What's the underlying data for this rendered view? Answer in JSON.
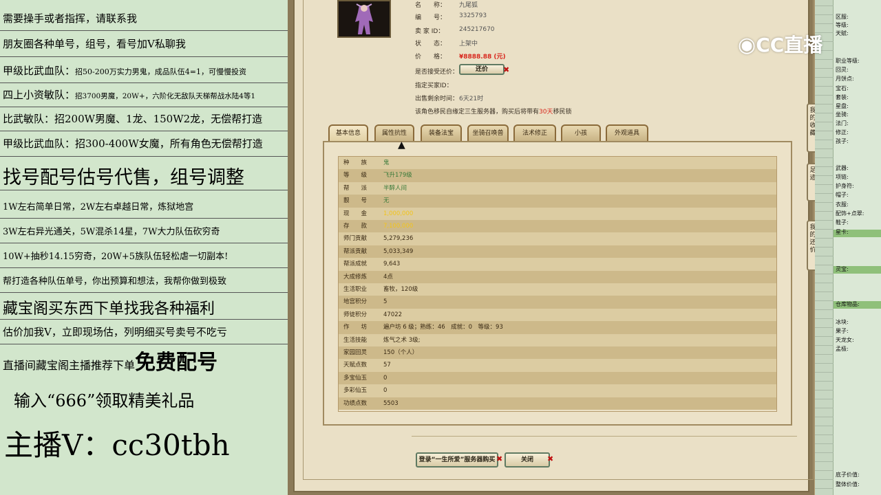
{
  "promo": {
    "l1": "需要操手或者指挥，请联系我",
    "l2": "朋友圈各种单号，组号，看号加Ⅴ私聊我",
    "l3a": "甲级比武血队：",
    "l3b": "招50-200万实力男鬼，成品队伍4=1，可慢慢投资",
    "l4a": "四上小资敏队：",
    "l4b": "招3700男魔，20W+，六阶化无敌队天梯帮战水陆4等1",
    "l5": "比武敏队：招200W男魔、1龙、150W2龙，无偿帮打造",
    "l6": "甲级比武血队：招300-400W女魔，所有角色无偿帮打造",
    "l7": "找号配号估号代售，组号调整",
    "l8": "1W左右简单日常，2W左右卓越日常，炼狱地宫",
    "l9": "3W左右异光通关，5W混杀14星，7W大力队伍砍穷奇",
    "l10": "10W+抽秒14.15穷奇，20W+5族队伍轻松虐一切副本!",
    "l11": "帮打造各种队伍单号，你出预算和想法，我帮你做到极致",
    "l12": "藏宝阁买东西下单找我各种福利",
    "l13": "估价加我Ⅴ，立即现场估，列明细买号卖号不吃亏",
    "l14a": "直播间藏宝阁主播推荐下单",
    "l14b": "免费配号",
    "l15": "输入“666”领取精美礼品",
    "l16": "主播Ⅴ：cc30tbh"
  },
  "listing": {
    "name_label": "名　　称：",
    "name": "九尾狐",
    "id_label": "编　　号：",
    "id": "3325793",
    "seller_label": "卖 家 ID：",
    "seller": "245217670",
    "status_label": "状　　态：",
    "status": "上架中",
    "price_label": "价　　格：",
    "price": "¥8888.88 (元)",
    "bargain_label": "是否接受还价：",
    "bargain_button": "还价",
    "buyer_label": "指定买家ID：",
    "time_label": "出售剩余时间：",
    "time": "6天21时",
    "notice_a": "该角色移民自缘定三生服务器，购买后将带有",
    "notice_days": "30天",
    "notice_b": "移民锁"
  },
  "tabs": [
    "基本信息",
    "属性抗性",
    "装备法宝",
    "坐骑召唤兽",
    "法术修正",
    "小孩",
    "外观道具"
  ],
  "side_tabs": {
    "fav": "我的收藏",
    "trace": "足迹",
    "bargain": "我的还价"
  },
  "stats": [
    {
      "k": "种　　族",
      "v": "鬼"
    },
    {
      "k": "等　　级",
      "v": "飞升179级"
    },
    {
      "k": "帮　　派",
      "v": "半醉人间"
    },
    {
      "k": "靓　　号",
      "v": "无"
    },
    {
      "k": "现　　金",
      "v": "1,000,000"
    },
    {
      "k": "存　　款",
      "v": "7,100,000"
    },
    {
      "k": "师门贡献",
      "v": "5,279,236"
    },
    {
      "k": "帮派贡献",
      "v": "5,033,349"
    },
    {
      "k": "帮派成就",
      "v": "9,643"
    },
    {
      "k": "大成修炼",
      "v": "4点"
    },
    {
      "k": "生活职业",
      "v": "畜牧，120级"
    },
    {
      "k": "地宫积分",
      "v": "5"
    },
    {
      "k": "师徒积分",
      "v": "47022"
    },
    {
      "k": "作　　坊",
      "v": "遍户坊 6 级；熟练：46　成就：0　等级：93"
    },
    {
      "k": "生活技能",
      "v": "炼气之术 3级;"
    },
    {
      "k": "家园回灵",
      "v": "150（个人）"
    },
    {
      "k": "天赋点数",
      "v": "57"
    },
    {
      "k": "多宝仙玉",
      "v": "0"
    },
    {
      "k": "多彩仙玉",
      "v": "0"
    },
    {
      "k": "功绩点数",
      "v": "5503"
    }
  ],
  "bottom": {
    "login": "登录“一生所爱”服务器购买",
    "close": "关闭"
  },
  "side_labels": [
    "区服:",
    "等级:",
    "天赋:",
    "职业等级:",
    "回灵:",
    "月饼点:",
    "宝石:",
    "套装:",
    "星盘:",
    "坐骑:",
    "法门:",
    "修正:",
    "孩子:",
    "武器:",
    "项链:",
    "护身符:",
    "帽子:",
    "衣服:",
    "配饰+点翠:",
    "鞋子:",
    "星卡:",
    "灵宝:",
    "仓库物品:",
    "冰块:",
    "果子:",
    "天龙女:",
    "孟极:",
    "底子价值:",
    "整体价值:"
  ],
  "logo": "CC直播",
  "colors": {
    "price": "#d8261c",
    "gold": "#f2c41b",
    "green_text": "#3a7a3a",
    "highlight": "#8fc07a"
  }
}
